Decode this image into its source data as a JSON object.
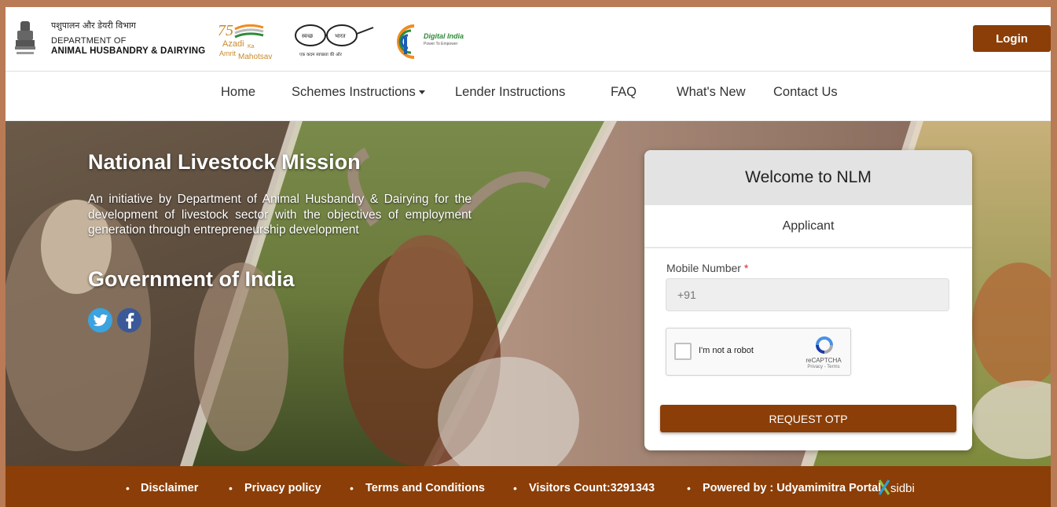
{
  "header": {
    "dept_hindi": "पशुपालन और डेयरी विभाग",
    "dept_line1": "DEPARTMENT OF",
    "dept_line2": "ANIMAL HUSBANDRY & DAIRYING",
    "azadi_line1": "Azadi",
    "azadi_line2": "Ka",
    "azadi_line3": "Amrit",
    "azadi_line4": "Mahotsav",
    "swachh_left": "स्वच्छ",
    "swachh_right": "भारत",
    "swachh_tagline": "एक कदम स्वच्छता की ओर",
    "digital_india": "Digital India",
    "digital_tagline": "Power To Empower",
    "login_label": "Login"
  },
  "nav": {
    "items": [
      {
        "label": "Home"
      },
      {
        "label": "Schemes Instructions"
      },
      {
        "label": "Lender Instructions"
      },
      {
        "label": "FAQ"
      },
      {
        "label": "What's New"
      },
      {
        "label": "Contact Us"
      }
    ]
  },
  "hero": {
    "title": "National Livestock Mission",
    "description": "An initiative by Department of Animal Husbandry & Dairying for the development of livestock sector with the objectives of employment generation through entrepreneurship development",
    "gov_title": "Government of India",
    "social": [
      "twitter-icon",
      "facebook-icon"
    ]
  },
  "login_card": {
    "heading": "Welcome to NLM",
    "tab": "Applicant",
    "mobile_label": "Mobile Number",
    "required_mark": "*",
    "mobile_placeholder": "+91",
    "captcha_text": "I'm not a robot",
    "captcha_brand": "reCAPTCHA",
    "captcha_links": "Privacy - Terms",
    "otp_button": "REQUEST OTP"
  },
  "footer": {
    "items": [
      {
        "label": "Disclaimer"
      },
      {
        "label": "Privacy policy"
      },
      {
        "label": "Terms and Conditions"
      },
      {
        "label": "Visitors Count:3291343"
      },
      {
        "label": "Powered by : Udyamimitra Portal"
      }
    ],
    "sidbi": "sidbi"
  },
  "colors": {
    "brand_brown": "#8b3e07",
    "page_border": "#b97a56"
  }
}
